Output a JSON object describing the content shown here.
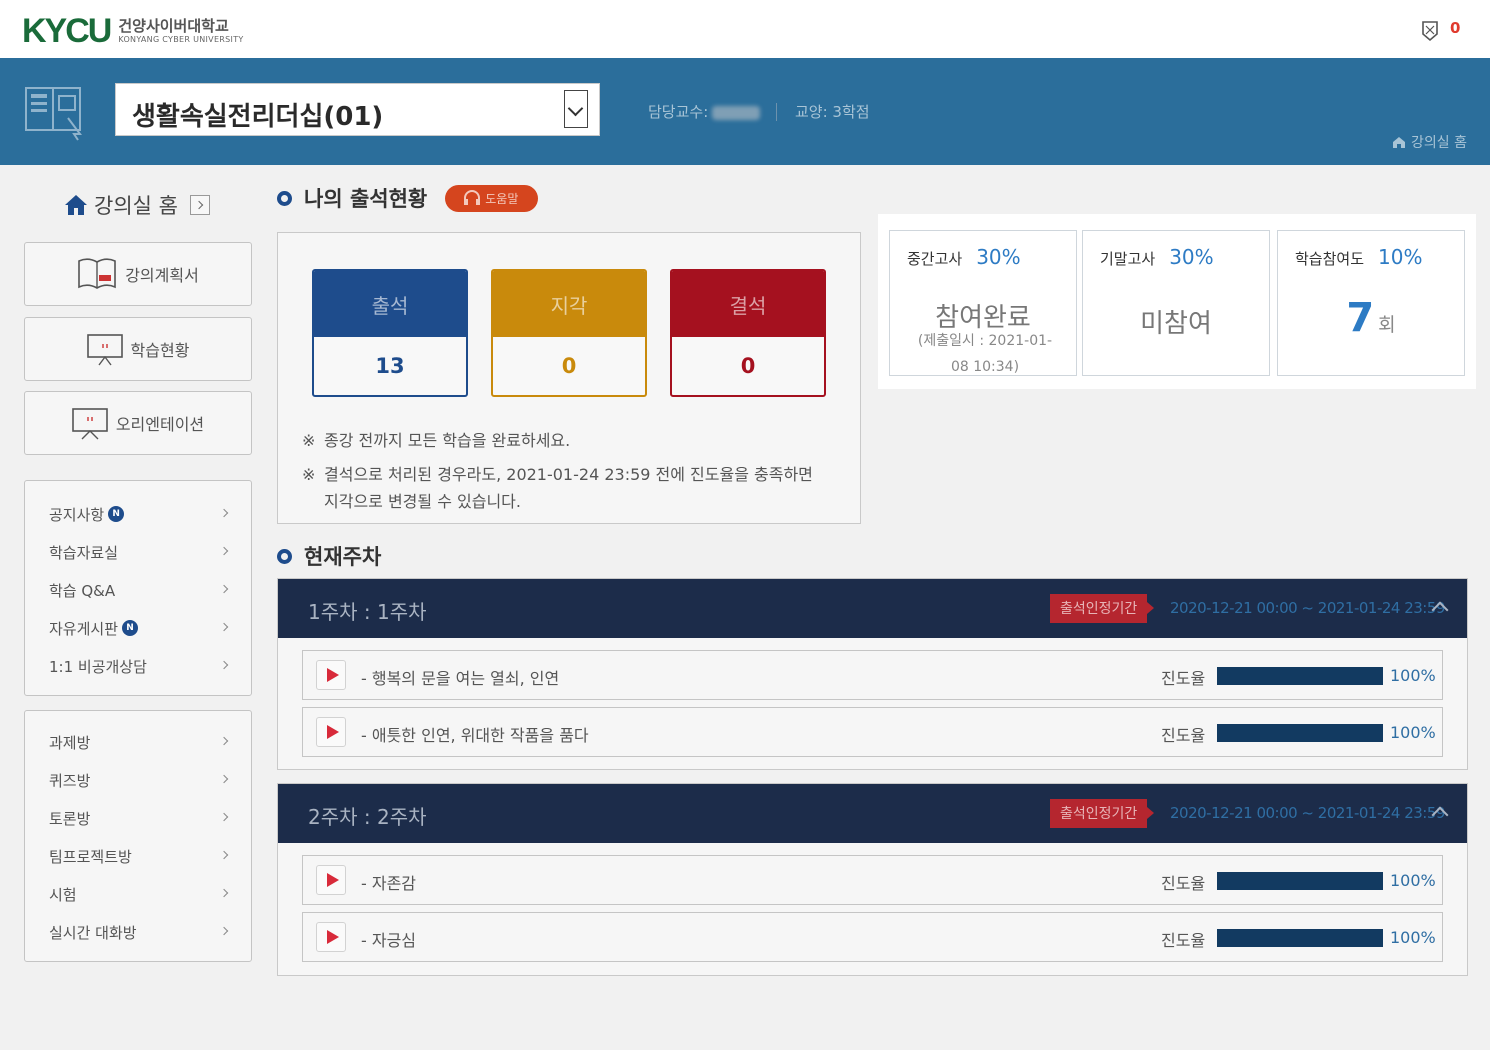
{
  "header": {
    "logo_mark": "KYCU",
    "logo_korean": "건양사이버대학교",
    "logo_english": "KONYANG CYBER UNIVERSITY",
    "notification_count": "0"
  },
  "course_bar": {
    "course_name": "생활속실전리더십(01)",
    "professor_label": "담당교수:",
    "credit": "교양: 3학점",
    "home_link": "강의실 홈"
  },
  "sidebar": {
    "home_label": "강의실 홈",
    "buttons": [
      {
        "label": "강의계획서",
        "icon": "syllabus-book-icon"
      },
      {
        "label": "학습현황",
        "icon": "monitor-icon"
      },
      {
        "label": "오리엔테이션",
        "icon": "presentation-icon"
      }
    ],
    "menu1": [
      {
        "label": "공지사항",
        "badge": "N"
      },
      {
        "label": "학습자료실",
        "badge": ""
      },
      {
        "label": "학습 Q&A",
        "badge": ""
      },
      {
        "label": "자유게시판",
        "badge": "N"
      },
      {
        "label": "1:1 비공개상담",
        "badge": ""
      }
    ],
    "menu2": [
      {
        "label": "과제방"
      },
      {
        "label": "퀴즈방"
      },
      {
        "label": "토론방"
      },
      {
        "label": "팀프로젝트방"
      },
      {
        "label": "시험"
      },
      {
        "label": "실시간 대화방"
      }
    ]
  },
  "attendance": {
    "title": "나의 출석현황",
    "help_label": "도움말",
    "boxes": [
      {
        "label": "출석",
        "value": "13",
        "color": "#1e4c8c",
        "value_color": "#1e4c8c"
      },
      {
        "label": "지각",
        "value": "0",
        "color": "#c98a0c",
        "value_color": "#c98a0c"
      },
      {
        "label": "결석",
        "value": "0",
        "color": "#a5111f",
        "value_color": "#a5111f"
      }
    ],
    "note_mark": "※",
    "note1": "종강 전까지 모든 학습을 완료하세요.",
    "note2_line1": "결석으로 처리된 경우라도, 2021-01-24 23:59 전에 진도율을 충족하면",
    "note2_line2": "지각으로 변경될 수 있습니다."
  },
  "exams": {
    "midterm": {
      "label": "중간고사",
      "percent": "30%",
      "status": "참여완료",
      "sub_line1": "(제출일시 : 2021-01-",
      "sub_line2": "08 10:34)"
    },
    "final": {
      "label": "기말고사",
      "percent": "30%",
      "status": "미참여"
    },
    "participation": {
      "label": "학습참여도",
      "percent": "10%",
      "count": "7",
      "unit": "회"
    }
  },
  "current_week": {
    "title": "현재주차",
    "progress_label": "진도율",
    "weeks": [
      {
        "title": "1주차 : 1주차",
        "badge": "출석인정기간",
        "period": "2020-12-21 00:00 ~ 2021-01-24 23:59",
        "lessons": [
          {
            "title": "- 행복의 문을 여는 열쇠, 인연",
            "progress": 100,
            "progress_text": "100%"
          },
          {
            "title": "- 애틋한 인연, 위대한 작품을 품다",
            "progress": 100,
            "progress_text": "100%"
          }
        ]
      },
      {
        "title": "2주차 : 2주차",
        "badge": "출석인정기간",
        "period": "2020-12-21 00:00 ~ 2021-01-24 23:59",
        "lessons": [
          {
            "title": "- 자존감",
            "progress": 100,
            "progress_text": "100%"
          },
          {
            "title": "- 자긍심",
            "progress": 100,
            "progress_text": "100%"
          }
        ]
      }
    ]
  }
}
